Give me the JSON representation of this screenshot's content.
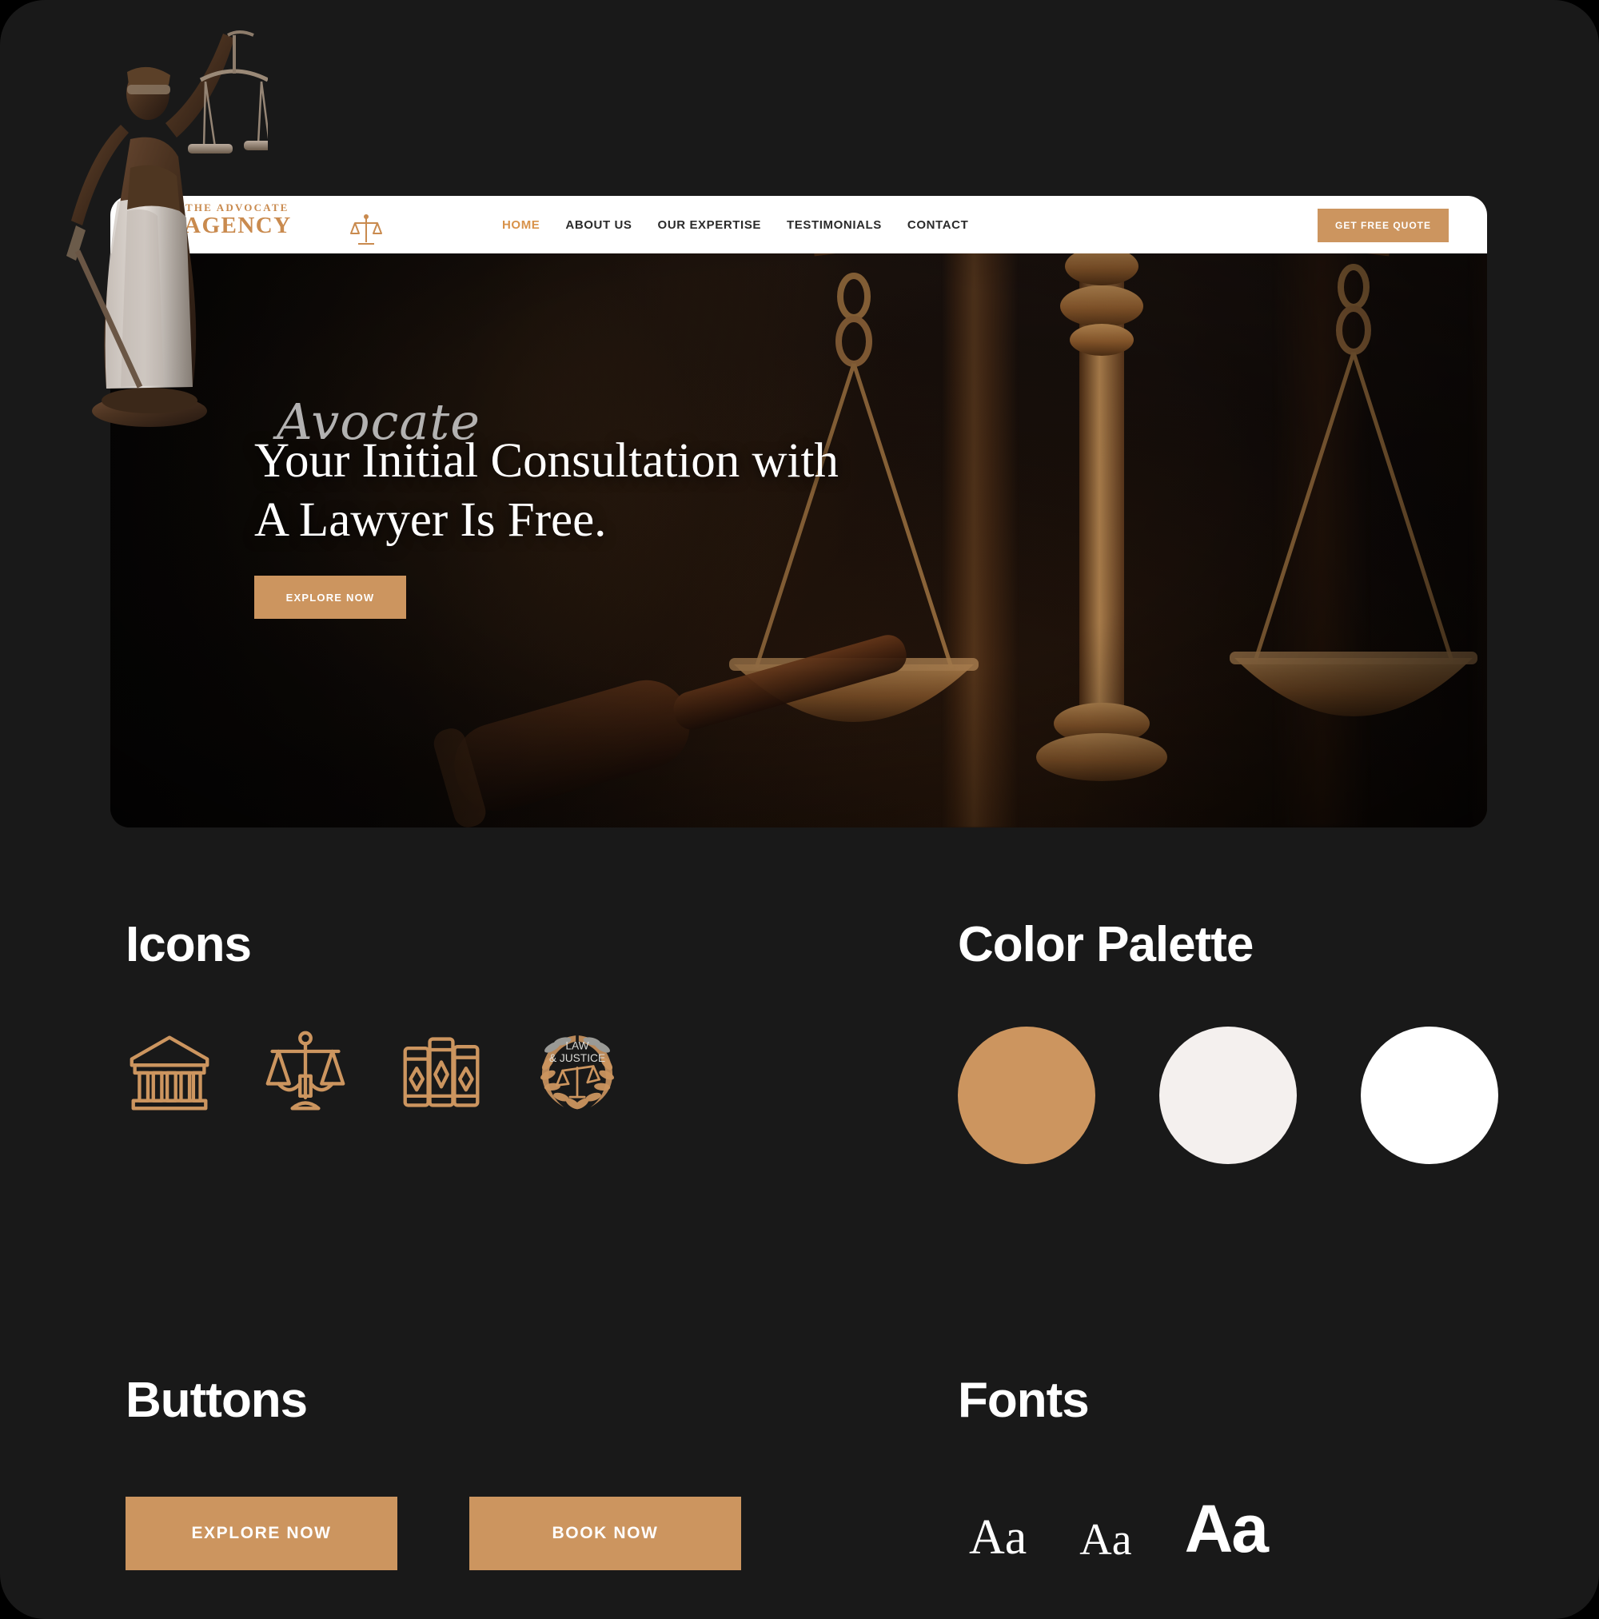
{
  "brand": {
    "accent": "#CC955F",
    "cream": "#F4F0EE",
    "white": "#FFFFFF",
    "background": "#191919"
  },
  "site": {
    "logo": {
      "line1": "THE ADVOCATE",
      "line2": "AGENCY"
    },
    "nav": [
      {
        "label": "HOME",
        "active": true
      },
      {
        "label": "ABOUT US",
        "active": false
      },
      {
        "label": "OUR EXPERTISE",
        "active": false
      },
      {
        "label": "TESTIMONIALS",
        "active": false
      },
      {
        "label": "CONTACT",
        "active": false
      }
    ],
    "cta": "GET FREE QUOTE",
    "hero": {
      "script": "Avocate",
      "title": "Your Initial Consultation with A Lawyer Is Free.",
      "button": "EXPLORE NOW"
    }
  },
  "guide": {
    "icons": {
      "heading": "Icons",
      "items": [
        {
          "name": "courthouse-icon"
        },
        {
          "name": "scales-of-justice-icon"
        },
        {
          "name": "law-books-icon"
        },
        {
          "name": "law-justice-laurel-badge-icon",
          "text_line1": "LAW",
          "text_line2": "& JUSTICE"
        }
      ]
    },
    "palette": {
      "heading": "Color Palette",
      "swatches": [
        {
          "name": "accent-copper",
          "hex": "#CC955F"
        },
        {
          "name": "cream-off-white",
          "hex": "#F4F0EE"
        },
        {
          "name": "pure-white",
          "hex": "#FFFFFF"
        }
      ]
    },
    "buttons": {
      "heading": "Buttons",
      "items": [
        {
          "label": "EXPLORE NOW"
        },
        {
          "label": "BOOK NOW"
        }
      ]
    },
    "fonts": {
      "heading": "Fonts",
      "samples": [
        {
          "label": "Aa",
          "style": "serif-regular"
        },
        {
          "label": "Aa",
          "style": "serif-regular-small"
        },
        {
          "label": "Aa",
          "style": "sans-bold-large"
        }
      ]
    }
  }
}
